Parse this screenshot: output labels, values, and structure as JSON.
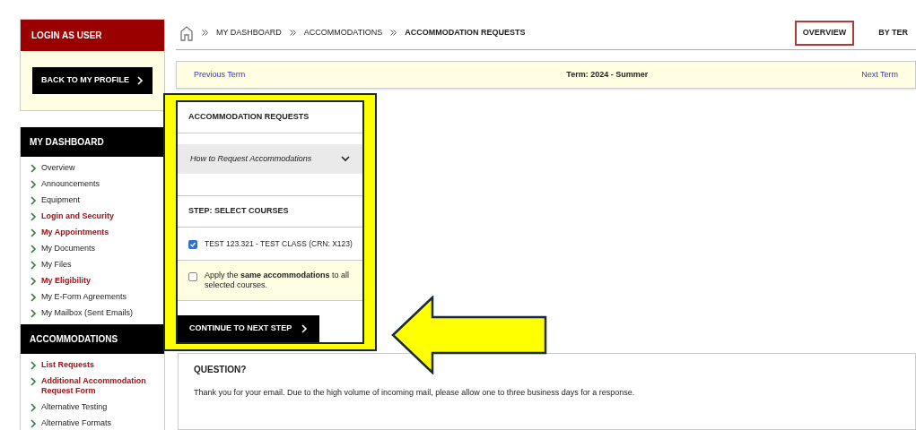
{
  "sidebar": {
    "login_panel": {
      "title": "LOGIN AS USER",
      "button": "BACK TO MY PROFILE"
    },
    "sections": [
      {
        "title": "MY DASHBOARD",
        "items": [
          {
            "label": "Overview",
            "emphasized": false
          },
          {
            "label": "Announcements",
            "emphasized": false
          },
          {
            "label": "Equipment",
            "emphasized": false
          },
          {
            "label": "Login and Security",
            "emphasized": true
          },
          {
            "label": "My Appointments",
            "emphasized": true
          },
          {
            "label": "My Documents",
            "emphasized": false
          },
          {
            "label": "My Files",
            "emphasized": false
          },
          {
            "label": "My Eligibility",
            "emphasized": true
          },
          {
            "label": "My E-Form Agreements",
            "emphasized": false
          },
          {
            "label": "My Mailbox (Sent Emails)",
            "emphasized": false
          }
        ]
      },
      {
        "title": "ACCOMMODATIONS",
        "items": [
          {
            "label": "List Requests",
            "emphasized": true
          },
          {
            "label": "Additional Accommodation Request Form",
            "emphasized": true
          },
          {
            "label": "Alternative Testing",
            "emphasized": false
          },
          {
            "label": "Alternative Formats",
            "emphasized": false
          }
        ]
      }
    ]
  },
  "breadcrumb": [
    "MY DASHBOARD",
    "ACCOMMODATIONS",
    "ACCOMMODATION REQUESTS"
  ],
  "tabs": [
    {
      "label": "OVERVIEW",
      "selected": true
    },
    {
      "label": "BY TER",
      "selected": false
    }
  ],
  "term_bar": {
    "previous": "Previous Term",
    "term": "Term: 2024 - Summer",
    "next": "Next Term"
  },
  "request_card": {
    "title": "ACCOMMODATION REQUESTS",
    "accordion": {
      "label": "How to Request Accommodations",
      "expanded": false
    },
    "step_title": "STEP: SELECT COURSES",
    "courses": [
      {
        "label": "TEST 123.321 - TEST CLASS (CRN: X123)",
        "checked": true
      }
    ],
    "apply_all": {
      "label": "Apply the **same accommodations** to all selected courses.",
      "checked": false
    },
    "button": "CONTINUE TO NEXT STEP"
  },
  "question": {
    "title": "QUESTION?",
    "text": "Thank you for your email. Due to the high volume of incoming mail, please allow one to three business days for a response."
  }
}
